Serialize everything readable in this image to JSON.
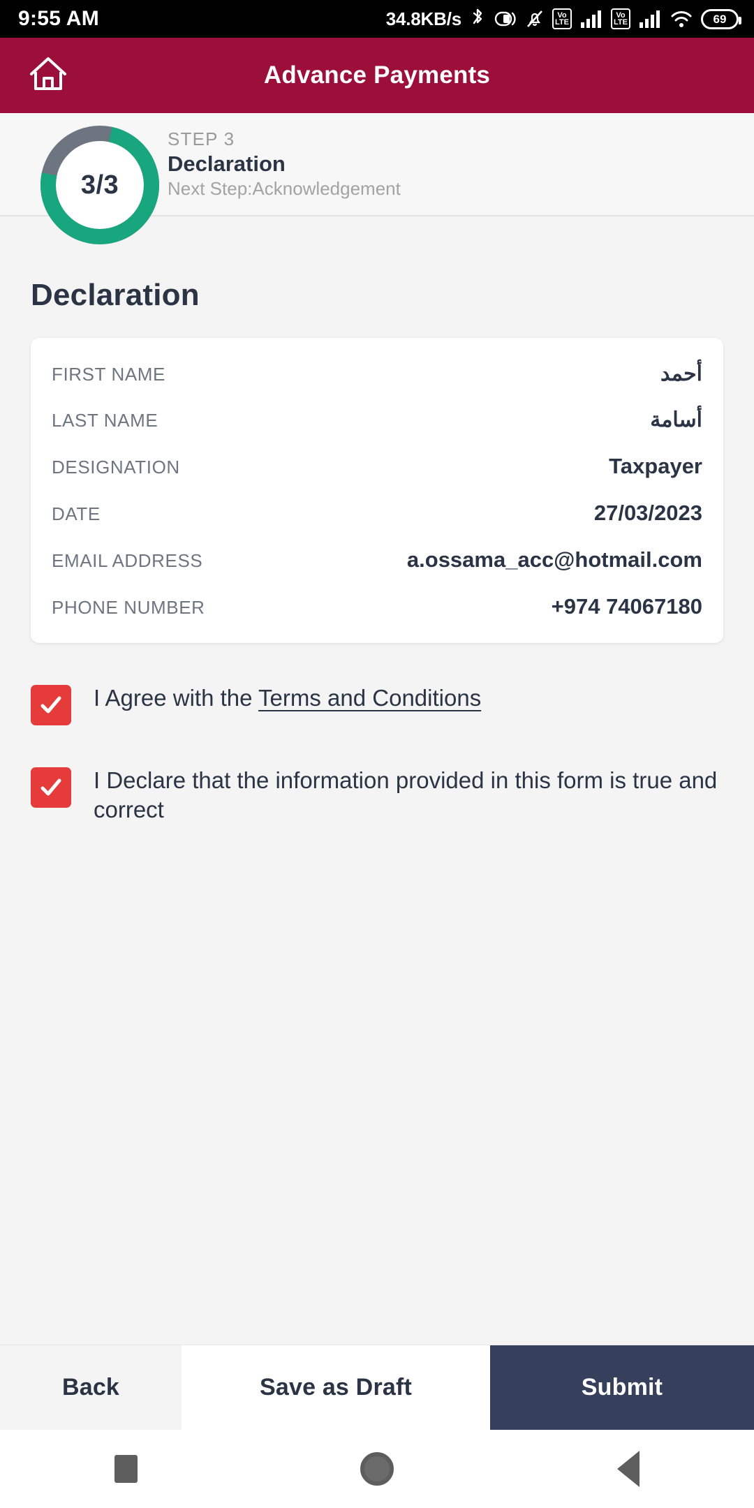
{
  "status_bar": {
    "time": "9:55 AM",
    "network_speed": "34.8KB/s",
    "battery_level": "69",
    "volte_label_top": "Vo",
    "volte_label_bottom": "LTE",
    "icons": [
      "bluetooth-icon",
      "do-not-disturb-icon",
      "mute-icon",
      "volte-icon",
      "signal-icon",
      "volte-icon",
      "signal-icon",
      "wifi-icon",
      "battery-icon"
    ]
  },
  "header": {
    "title": "Advance Payments",
    "home_icon": "home-icon",
    "background_color": "#9c0f3b"
  },
  "stepper": {
    "counter": "3/3",
    "eyebrow": "STEP 3",
    "title": "Declaration",
    "next_step": "Next Step:Acknowledgement",
    "progress_color": "#17a67e",
    "track_color": "#6d7680",
    "percent_complete": 75
  },
  "main": {
    "page_title": "Declaration",
    "fields": [
      {
        "label": "FIRST NAME",
        "value": "أحمد",
        "arabic": true
      },
      {
        "label": "LAST NAME",
        "value": "أسامة",
        "arabic": true
      },
      {
        "label": "DESIGNATION",
        "value": "Taxpayer",
        "arabic": false
      },
      {
        "label": "DATE",
        "value": "27/03/2023",
        "arabic": false
      },
      {
        "label": "EMAIL ADDRESS",
        "value": "a.ossama_acc@hotmail.com",
        "arabic": false
      },
      {
        "label": "PHONE NUMBER",
        "value": "+974 74067180",
        "arabic": false
      }
    ],
    "checkboxes": [
      {
        "checked": true,
        "text_before": "I Agree with the ",
        "link_text": "Terms and Conditions",
        "text_after": ""
      },
      {
        "checked": true,
        "text_before": "I Declare that the information provided in this form is true and correct",
        "link_text": "",
        "text_after": ""
      }
    ],
    "checkbox_color": "#e63b3b"
  },
  "actions": {
    "back_label": "Back",
    "draft_label": "Save as Draft",
    "submit_label": "Submit",
    "submit_color": "#36405c"
  },
  "nav_bar": {
    "recent_icon": "square-recents-icon",
    "home_icon": "circle-home-icon",
    "back_icon": "triangle-back-icon"
  }
}
